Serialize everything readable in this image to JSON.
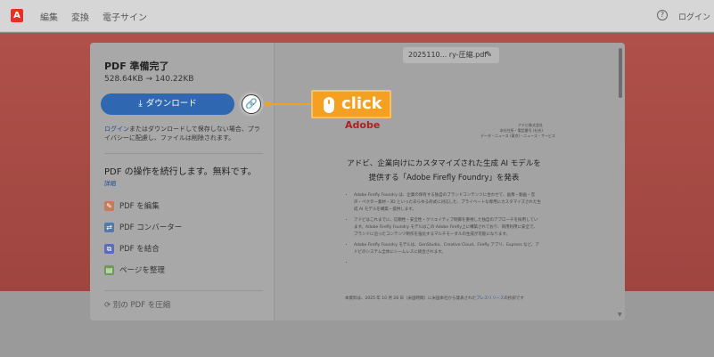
{
  "topbar": {
    "logo_glyph": "⭕",
    "menu": [
      "編集",
      "変換",
      "電子サイン"
    ],
    "help_glyph": "?",
    "login": "ログイン"
  },
  "panel": {
    "title": "PDF 準備完了",
    "size": "528.64KB → 140.22KB",
    "download_label": "ダウンロード",
    "download_icon": "download-icon",
    "link_icon": "link-icon",
    "note_link": "ログイン",
    "note_text": "またはダウンロードして保存しない場合、プライバシーに配慮し、ファイルは削除されます。",
    "section_title": "PDF の操作を続行します。無料です。",
    "section_detail": "詳細",
    "tools": [
      {
        "label": "PDF を編集",
        "icon": "edit-pdf-icon"
      },
      {
        "label": "PDF コンバーター",
        "icon": "convert-pdf-icon"
      },
      {
        "label": "PDF を結合",
        "icon": "combine-pdf-icon"
      },
      {
        "label": "ページを整理",
        "icon": "organize-pages-icon"
      }
    ],
    "compress_label": "別の PDF を圧縮"
  },
  "preview": {
    "filename": "2025110... ry-圧縮.pdf",
    "brand": "Adobe",
    "meta": [
      "アドビ株式会社",
      "本社住所・電話番号 (社名)",
      "データ・ニュース (東京)・ニューズ・サービス"
    ],
    "headline_1": "アドビ、企業向けにカスタマイズされた生成 AI モデルを",
    "headline_2": "提供する「Adobe Firefly Foundry」を発表",
    "bullets": [
      "Adobe Firefly Foundry は、企業の保有する独自のブランドコンテンツに合わせて、画像・動画・音声・ベクター素材・3D といったあらゆる形式に対応した、プライベートな専用にカスタマイズされた生成 AI モデルを構築・提供します。",
      "アドビはこれまでに、信頼性・安全性・クリエイティブ制御を重視した独自のアプローチを採用しています。Adobe Firefly Foundry モデルはこの Adobe Firefly上に構築されており、商用利用に安全で、ブランドに沿ったコンテンツ制作を強化するマルチモーダルの生成が可能になります。",
      "Adobe Firefly Foundry モデルは、GenStudio、Creative Cloud、Firefly アプリ、Express など、アドビのシステム全体にシームレスに統合されます。",
      ""
    ],
    "para_text": "本資料は、2025 年 10 月 28 日（米国時間）に米国本社から発表された",
    "para_link": "プレスリリース",
    "para_tail": "の抄訳です"
  },
  "annotation": {
    "label": "click",
    "icon": "mouse-icon",
    "color": "#f5a020"
  },
  "colors": {
    "accent": "#2f68b0",
    "brand": "#e0322b",
    "band": "#b0504a"
  }
}
